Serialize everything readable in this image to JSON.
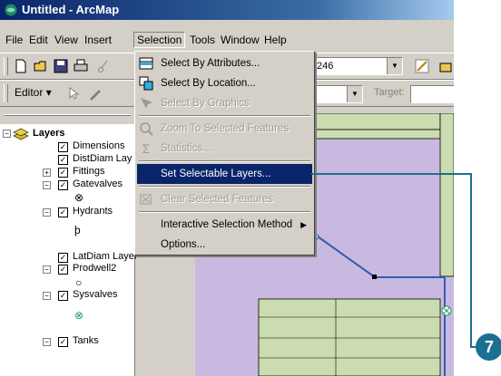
{
  "window": {
    "title": "Untitled - ArcMap"
  },
  "menubar": [
    "File",
    "Edit",
    "View",
    "Insert",
    "Selection",
    "Tools",
    "Window",
    "Help"
  ],
  "toolbar": {
    "scale_value": "246",
    "editor_label": "Editor",
    "target_label": "Target:"
  },
  "toc": {
    "root": "Layers",
    "layers": [
      {
        "name": "Dimensions"
      },
      {
        "name": "DistDiam Lay"
      },
      {
        "name": "Fittings"
      },
      {
        "name": "Gatevalves"
      },
      {
        "name": "Hydrants"
      },
      {
        "name": "LatDiam Layer"
      },
      {
        "name": "Prodwell2"
      },
      {
        "name": "Sysvalves"
      },
      {
        "name": "Tanks"
      }
    ]
  },
  "selection_menu": [
    {
      "label": "Select By Attributes...",
      "icon": "select-attributes-icon",
      "disabled": false
    },
    {
      "label": "Select By Location...",
      "icon": "select-location-icon",
      "disabled": false
    },
    {
      "label": "Select By Graphics",
      "icon": "select-graphics-icon",
      "disabled": true
    },
    {
      "label": "Zoom To Selected Features",
      "icon": "zoom-selected-icon",
      "disabled": true
    },
    {
      "label": "Statistics...",
      "icon": "sigma-icon",
      "disabled": true
    },
    {
      "label": "Set Selectable Layers...",
      "icon": "",
      "disabled": false,
      "highlighted": true
    },
    {
      "label": "Clear Selected Features",
      "icon": "clear-selection-icon",
      "disabled": true
    },
    {
      "label": "Interactive Selection Method",
      "icon": "",
      "disabled": false,
      "submenu": true
    },
    {
      "label": "Options...",
      "icon": "",
      "disabled": false
    }
  ],
  "callout": {
    "number": "7",
    "color": "#1b6f93"
  },
  "colors": {
    "menu_highlight": "#0a246a",
    "map_parcel": "#c9b9e0",
    "map_green": "#cbdcb0",
    "map_line": "#2f5fb0"
  }
}
